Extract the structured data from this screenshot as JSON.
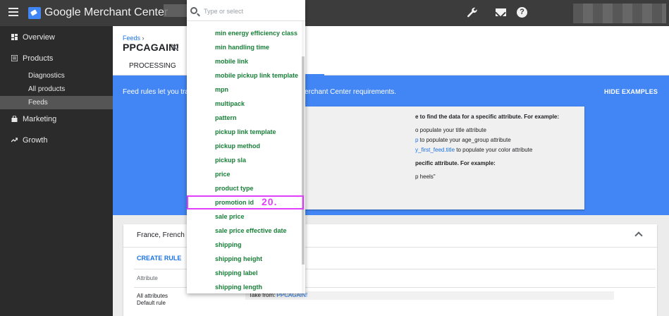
{
  "topbar": {
    "app_title": "Google Merchant Center"
  },
  "sidebar": {
    "items": [
      {
        "label": "Overview"
      },
      {
        "label": "Products"
      },
      {
        "label": "Diagnostics"
      },
      {
        "label": "All products"
      },
      {
        "label": "Feeds"
      },
      {
        "label": "Marketing"
      },
      {
        "label": "Growth"
      }
    ]
  },
  "header": {
    "breadcrumb": "Feeds",
    "breadcrumb_sep": "›",
    "title": "PPCAGAIN!",
    "close_glyph": "✕",
    "tab_processing": "PROCESSING"
  },
  "banner": {
    "text_left": "Feed rules let you tran",
    "text_right": "erchant Center requirements.",
    "hide_examples": "HIDE EXAMPLES",
    "examples": {
      "line1": "e to find the data for a specific attribute. For example:",
      "line2": "o populate your title attribute",
      "line3_link": "p",
      "line3_rest": " to populate your age_group attribute",
      "line4_link": "y_first_feed.title",
      "line4_rest": " to populate your color attribute",
      "line5": "pecific attribute. For example:",
      "line6": "p heels\""
    }
  },
  "card": {
    "title": "France, French",
    "create_rule": "CREATE RULE",
    "col_header": "Attribute",
    "row_attr_line1": "All attributes",
    "row_attr_line2": "Default rule",
    "row_value_prefix": "Take from: ",
    "row_value_link": "PPCAGAIN!"
  },
  "dropdown": {
    "search_placeholder": "Type or select",
    "items": [
      {
        "label": "min energy efficiency class"
      },
      {
        "label": "min handling time"
      },
      {
        "label": "mobile link"
      },
      {
        "label": "mobile pickup link template"
      },
      {
        "label": "mpn"
      },
      {
        "label": "multipack"
      },
      {
        "label": "pattern"
      },
      {
        "label": "pickup link template"
      },
      {
        "label": "pickup method"
      },
      {
        "label": "pickup sla"
      },
      {
        "label": "price"
      },
      {
        "label": "product type"
      },
      {
        "label": "promotion id"
      },
      {
        "label": "sale price"
      },
      {
        "label": "sale price effective date"
      },
      {
        "label": "shipping"
      },
      {
        "label": "shipping height"
      },
      {
        "label": "shipping label"
      },
      {
        "label": "shipping length"
      }
    ],
    "highlight_index": 12,
    "step_label": "20."
  },
  "colors": {
    "topbar": "#3c3c3c",
    "sidebar": "#2b2b2b",
    "banner": "#4285f4",
    "item_green": "#188038",
    "highlight": "#e040fb",
    "link_blue": "#1a73e8"
  }
}
